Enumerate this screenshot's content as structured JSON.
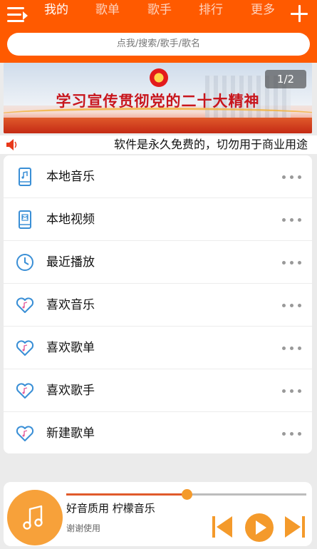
{
  "header": {
    "tabs": [
      {
        "label": "我的",
        "active": true
      },
      {
        "label": "歌单",
        "active": false
      },
      {
        "label": "歌手",
        "active": false
      },
      {
        "label": "排行",
        "active": false
      },
      {
        "label": "更多",
        "active": false
      }
    ],
    "accent_color": "#ff5a00"
  },
  "search": {
    "placeholder": "点我/搜索/歌手/歌名"
  },
  "banner": {
    "title": "学习宣传贯彻党的二十大精神",
    "pager": "1/2"
  },
  "notice": {
    "text": "软件是永久免费的，切勿用于商业用途"
  },
  "menu": [
    {
      "label": "本地音乐",
      "icon": "phone-music-icon"
    },
    {
      "label": "本地视频",
      "icon": "phone-video-icon"
    },
    {
      "label": "最近播放",
      "icon": "clock-icon"
    },
    {
      "label": "喜欢音乐",
      "icon": "heart-music-icon"
    },
    {
      "label": "喜欢歌单",
      "icon": "heart-music-icon"
    },
    {
      "label": "喜欢歌手",
      "icon": "heart-music-icon"
    },
    {
      "label": "新建歌单",
      "icon": "heart-music-icon"
    }
  ],
  "player": {
    "song": "好音质用 柠檬音乐",
    "artist": "谢谢使用",
    "progress": 0.5,
    "accent_color": "#f7a13a"
  }
}
